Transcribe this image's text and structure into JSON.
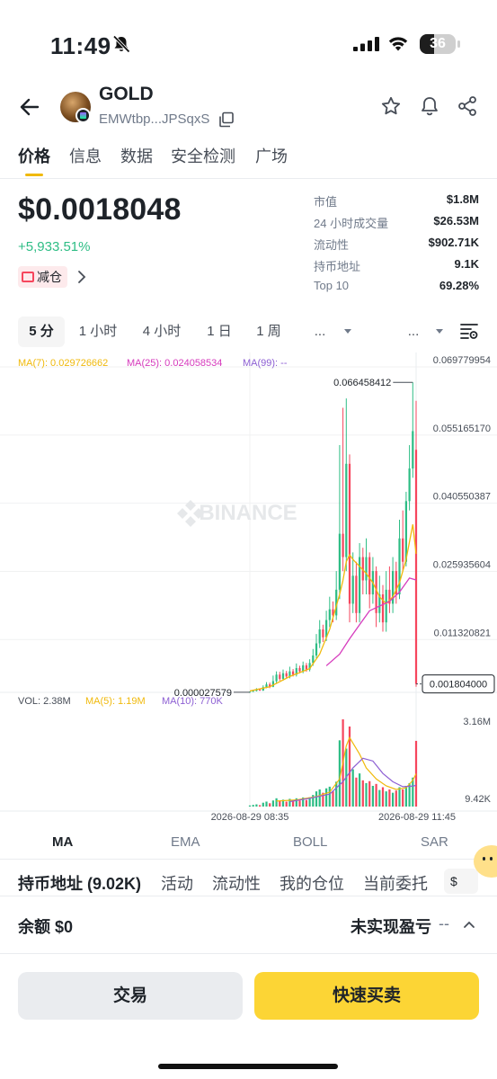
{
  "status_bar": {
    "time": "11:49",
    "battery": "36"
  },
  "header": {
    "title": "GOLD",
    "address": "EMWtbp...JPSqxS"
  },
  "tabs": [
    {
      "label": "价格",
      "active": true
    },
    {
      "label": "信息"
    },
    {
      "label": "数据"
    },
    {
      "label": "安全检测"
    },
    {
      "label": "广场"
    }
  ],
  "price": {
    "value": "$0.0018048",
    "change": "+5,933.51%",
    "tag": "减仓"
  },
  "stats": [
    {
      "label": "市值",
      "value": "$1.8M"
    },
    {
      "label": "24 小时成交量",
      "value": "$26.53M"
    },
    {
      "label": "流动性",
      "value": "$902.71K"
    },
    {
      "label": "持币地址",
      "value": "9.1K"
    },
    {
      "label": "Top 10",
      "value": "69.28%"
    }
  ],
  "intervals": [
    "5 分",
    "1 小时",
    "4 小时",
    "1 日",
    "1 周",
    "..."
  ],
  "interval_more": "...",
  "chart": {
    "ma_legend": {
      "ma7": "MA(7): 0.029726662",
      "ma25": "MA(25): 0.024058534",
      "ma99": "MA(99): --"
    },
    "y_ticks": [
      "0.069779954",
      "0.055165170",
      "0.040550387",
      "0.025935604",
      "0.011320821"
    ],
    "current_price_label": "0.001804000",
    "high_label": "0.066458412",
    "low_label": "0.000027579",
    "watermark": "BINANCE",
    "vol_legend": {
      "vol": "VOL: 2.38M",
      "ma5": "MA(5): 1.19M",
      "ma10": "MA(10): 770K"
    },
    "vol_ticks": [
      "3.16M",
      "9.42K"
    ],
    "x_labels": [
      "2026-08-29 08:35",
      "2026-08-29 11:45"
    ],
    "colors": {
      "up": "#2ebd85",
      "down": "#f6465d",
      "ma7": "#f0b90b",
      "ma25": "#d63bbd",
      "ma99": "#8d5fd3"
    }
  },
  "chart_data": {
    "type": "candlestick",
    "y_range": [
      0,
      0.069779954
    ],
    "candles": [
      {
        "o": 2.8e-05,
        "c": 0.00012,
        "h": 0.0002,
        "l": 2.7579e-05
      },
      {
        "o": 0.00012,
        "c": 0.0003,
        "h": 0.0004,
        "l": 0.0001
      },
      {
        "o": 0.0003,
        "c": 0.0006,
        "h": 0.0009,
        "l": 0.0002
      },
      {
        "o": 0.0006,
        "c": 0.0004,
        "h": 0.0008,
        "l": 0.0003
      },
      {
        "o": 0.0004,
        "c": 0.0011,
        "h": 0.0015,
        "l": 0.0003
      },
      {
        "o": 0.0011,
        "c": 0.0017,
        "h": 0.0022,
        "l": 0.0009
      },
      {
        "o": 0.0017,
        "c": 0.0012,
        "h": 0.0021,
        "l": 0.0009
      },
      {
        "o": 0.0012,
        "c": 0.0024,
        "h": 0.0036,
        "l": 0.0011
      },
      {
        "o": 0.0024,
        "c": 0.0038,
        "h": 0.0045,
        "l": 0.002
      },
      {
        "o": 0.0038,
        "c": 0.0029,
        "h": 0.0044,
        "l": 0.0025
      },
      {
        "o": 0.0029,
        "c": 0.0041,
        "h": 0.0049,
        "l": 0.0025
      },
      {
        "o": 0.0041,
        "c": 0.0034,
        "h": 0.0046,
        "l": 0.003
      },
      {
        "o": 0.0034,
        "c": 0.0045,
        "h": 0.0055,
        "l": 0.003
      },
      {
        "o": 0.0045,
        "c": 0.0038,
        "h": 0.005,
        "l": 0.0034
      },
      {
        "o": 0.0038,
        "c": 0.0052,
        "h": 0.0062,
        "l": 0.0034
      },
      {
        "o": 0.0052,
        "c": 0.0045,
        "h": 0.0057,
        "l": 0.0041
      },
      {
        "o": 0.0045,
        "c": 0.0058,
        "h": 0.0066,
        "l": 0.0041
      },
      {
        "o": 0.0058,
        "c": 0.0049,
        "h": 0.0063,
        "l": 0.0044
      },
      {
        "o": 0.0049,
        "c": 0.0063,
        "h": 0.0071,
        "l": 0.0045
      },
      {
        "o": 0.0063,
        "c": 0.0079,
        "h": 0.0093,
        "l": 0.0057
      },
      {
        "o": 0.0079,
        "c": 0.0105,
        "h": 0.0125,
        "l": 0.0073
      },
      {
        "o": 0.0105,
        "c": 0.0135,
        "h": 0.0155,
        "l": 0.0095
      },
      {
        "o": 0.0135,
        "c": 0.0118,
        "h": 0.0145,
        "l": 0.0108
      },
      {
        "o": 0.0118,
        "c": 0.0155,
        "h": 0.0175,
        "l": 0.011
      },
      {
        "o": 0.0155,
        "c": 0.0178,
        "h": 0.0205,
        "l": 0.014
      },
      {
        "o": 0.0178,
        "c": 0.0165,
        "h": 0.0195,
        "l": 0.015
      },
      {
        "o": 0.0165,
        "c": 0.022,
        "h": 0.026,
        "l": 0.0155
      },
      {
        "o": 0.022,
        "c": 0.034,
        "h": 0.053,
        "l": 0.02
      },
      {
        "o": 0.034,
        "c": 0.029,
        "h": 0.061,
        "l": 0.026
      },
      {
        "o": 0.029,
        "c": 0.049,
        "h": 0.063,
        "l": 0.026
      },
      {
        "o": 0.049,
        "c": 0.019,
        "h": 0.051,
        "l": 0.015
      },
      {
        "o": 0.019,
        "c": 0.025,
        "h": 0.03,
        "l": 0.017
      },
      {
        "o": 0.025,
        "c": 0.017,
        "h": 0.028,
        "l": 0.015
      },
      {
        "o": 0.017,
        "c": 0.029,
        "h": 0.032,
        "l": 0.015
      },
      {
        "o": 0.029,
        "c": 0.024,
        "h": 0.031,
        "l": 0.021
      },
      {
        "o": 0.024,
        "c": 0.029,
        "h": 0.033,
        "l": 0.021
      },
      {
        "o": 0.029,
        "c": 0.021,
        "h": 0.03,
        "l": 0.018
      },
      {
        "o": 0.021,
        "c": 0.026,
        "h": 0.029,
        "l": 0.019
      },
      {
        "o": 0.026,
        "c": 0.017,
        "h": 0.027,
        "l": 0.014
      },
      {
        "o": 0.017,
        "c": 0.021,
        "h": 0.025,
        "l": 0.015
      },
      {
        "o": 0.021,
        "c": 0.015,
        "h": 0.023,
        "l": 0.013
      },
      {
        "o": 0.015,
        "c": 0.022,
        "h": 0.026,
        "l": 0.013
      },
      {
        "o": 0.022,
        "c": 0.019,
        "h": 0.027,
        "l": 0.017
      },
      {
        "o": 0.019,
        "c": 0.026,
        "h": 0.029,
        "l": 0.017
      },
      {
        "o": 0.026,
        "c": 0.021,
        "h": 0.028,
        "l": 0.019
      },
      {
        "o": 0.021,
        "c": 0.033,
        "h": 0.037,
        "l": 0.02
      },
      {
        "o": 0.033,
        "c": 0.028,
        "h": 0.039,
        "l": 0.026
      },
      {
        "o": 0.028,
        "c": 0.041,
        "h": 0.043,
        "l": 0.027
      },
      {
        "o": 0.041,
        "c": 0.048,
        "h": 0.053,
        "l": 0.039
      },
      {
        "o": 0.048,
        "c": 0.056,
        "h": 0.066458412,
        "l": 0.046
      },
      {
        "o": 0.052,
        "c": 0.001804,
        "h": 0.0625,
        "l": 0.0012
      }
    ],
    "ma7": [
      [
        0,
        0.0003
      ],
      [
        6,
        0.0012
      ],
      [
        12,
        0.0034
      ],
      [
        18,
        0.0051
      ],
      [
        21,
        0.0082
      ],
      [
        24,
        0.0135
      ],
      [
        27,
        0.021
      ],
      [
        28,
        0.024
      ],
      [
        29,
        0.028
      ],
      [
        30,
        0.0295
      ],
      [
        31,
        0.0285
      ],
      [
        33,
        0.027
      ],
      [
        35,
        0.0255
      ],
      [
        37,
        0.0235
      ],
      [
        39,
        0.0205
      ],
      [
        41,
        0.019
      ],
      [
        43,
        0.0205
      ],
      [
        45,
        0.0235
      ],
      [
        47,
        0.0285
      ],
      [
        49,
        0.036
      ],
      [
        50,
        0.0297
      ]
    ],
    "ma25": [
      [
        23,
        0.0057
      ],
      [
        27,
        0.0082
      ],
      [
        30,
        0.0115
      ],
      [
        33,
        0.0145
      ],
      [
        36,
        0.0175
      ],
      [
        39,
        0.0185
      ],
      [
        42,
        0.0195
      ],
      [
        45,
        0.0215
      ],
      [
        48,
        0.0245
      ],
      [
        50,
        0.0241
      ]
    ],
    "volume": [
      0.04,
      0.06,
      0.08,
      0.05,
      0.14,
      0.18,
      0.12,
      0.22,
      0.3,
      0.2,
      0.25,
      0.18,
      0.28,
      0.2,
      0.3,
      0.22,
      0.33,
      0.24,
      0.34,
      0.42,
      0.55,
      0.62,
      0.5,
      0.66,
      0.72,
      0.55,
      0.9,
      2.4,
      3.16,
      2.1,
      2.9,
      1.35,
      1.05,
      1.2,
      0.95,
      0.85,
      0.92,
      0.75,
      0.82,
      0.6,
      0.7,
      0.55,
      0.62,
      0.5,
      0.58,
      0.7,
      0.62,
      0.75,
      0.85,
      1.05,
      2.38
    ],
    "vol_ma5": [
      [
        8,
        0.2
      ],
      [
        14,
        0.24
      ],
      [
        20,
        0.36
      ],
      [
        24,
        0.52
      ],
      [
        27,
        1.0
      ],
      [
        28,
        1.6
      ],
      [
        29,
        2.2
      ],
      [
        30,
        2.5
      ],
      [
        31,
        2.3
      ],
      [
        33,
        1.9
      ],
      [
        35,
        1.4
      ],
      [
        38,
        1.0
      ],
      [
        41,
        0.75
      ],
      [
        44,
        0.62
      ],
      [
        47,
        0.68
      ],
      [
        49,
        0.95
      ],
      [
        50,
        1.19
      ]
    ],
    "vol_ma10": [
      [
        12,
        0.18
      ],
      [
        18,
        0.3
      ],
      [
        24,
        0.45
      ],
      [
        28,
        0.9
      ],
      [
        31,
        1.4
      ],
      [
        34,
        1.75
      ],
      [
        37,
        1.65
      ],
      [
        40,
        1.2
      ],
      [
        43,
        0.9
      ],
      [
        46,
        0.72
      ],
      [
        49,
        0.74
      ],
      [
        50,
        0.77
      ]
    ]
  },
  "indicators": [
    "MA",
    "EMA",
    "BOLL",
    "SAR"
  ],
  "sub_tabs": [
    "持币地址 (9.02K)",
    "活动",
    "流动性",
    "我的仓位",
    "当前委托"
  ],
  "sub_tab_currency": "$",
  "position": {
    "balance": "余额 $0",
    "pnl_label": "未实现盈亏",
    "pnl_value": "--"
  },
  "actions": {
    "trade": "交易",
    "quick": "快速买卖"
  }
}
